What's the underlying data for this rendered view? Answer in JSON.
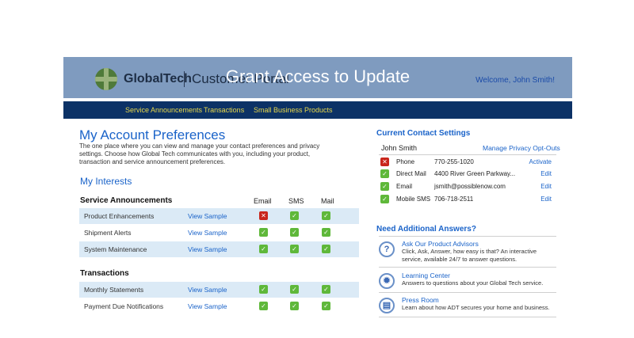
{
  "header": {
    "brand": "GlobalTech",
    "portal": "Customer Portal",
    "overlay_title": "Grant Access to Update",
    "welcome": "Welcome, John Smith!"
  },
  "nav": {
    "items": [
      "Service Announcements",
      "Transactions",
      "Small Business Products"
    ]
  },
  "main": {
    "title": "My Account Preferences",
    "intro": "The one place where you can view and manage your contact preferences and privacy settings. Choose how Global Tech communicates with you, including your product, transaction and service announcement preferences.",
    "interests_title": "My Interests",
    "columns": [
      "Email",
      "SMS",
      "Mail"
    ],
    "link_label": "View Sample",
    "sections": [
      {
        "title": "Service Announcements",
        "rows": [
          {
            "label": "Product Enhancements",
            "email": false,
            "sms": true,
            "mail": true
          },
          {
            "label": "Shipment Alerts",
            "email": true,
            "sms": true,
            "mail": true
          },
          {
            "label": "System Maintenance",
            "email": true,
            "sms": true,
            "mail": true
          }
        ]
      },
      {
        "title": "Transactions",
        "rows": [
          {
            "label": "Monthly Statements",
            "email": true,
            "sms": true,
            "mail": true
          },
          {
            "label": "Payment Due Notifications",
            "email": true,
            "sms": true,
            "mail": true
          }
        ]
      }
    ]
  },
  "contact": {
    "title": "Current Contact Settings",
    "name": "John Smith",
    "manage_link": "Manage Privacy Opt-Outs",
    "rows": [
      {
        "type": "Phone",
        "value": "770-255-1020",
        "action": "Activate",
        "enabled": false
      },
      {
        "type": "Direct Mail",
        "value": "4400 River Green Parkway...",
        "action": "Edit",
        "enabled": true
      },
      {
        "type": "Email",
        "value": "jsmith@possiblenow.com",
        "action": "Edit",
        "enabled": true
      },
      {
        "type": "Mobile SMS",
        "value": "706-718-2511",
        "action": "Edit",
        "enabled": true
      }
    ]
  },
  "help": {
    "title": "Need Additional Answers?",
    "items": [
      {
        "icon": "question-icon",
        "title": "Ask Our Product Advisors",
        "desc": "Click, Ask, Answer, how easy is that? An interactive service, available 24/7 to answer questions."
      },
      {
        "icon": "lightbulb-icon",
        "title": "Learning Center",
        "desc": "Answers to questions about your Global Tech service."
      },
      {
        "icon": "newspaper-icon",
        "title": "Press Room",
        "desc": "Learn about how ADT secures your home and business."
      }
    ]
  },
  "colors": {
    "header_bg": "#7f9bbf",
    "nav_bg": "#0c3266",
    "nav_text": "#e8d84a",
    "accent": "#1a63c9",
    "check_green": "#5fb83a",
    "x_red": "#c9261c",
    "row_alt": "#dbeaf6"
  }
}
